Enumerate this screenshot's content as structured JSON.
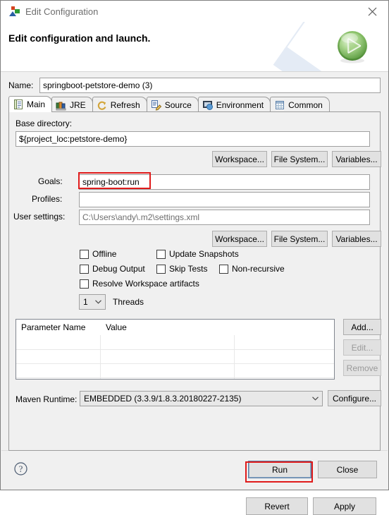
{
  "window": {
    "title": "Edit Configuration",
    "icon": "launch-config-icon",
    "close_label": "✕"
  },
  "header": {
    "title": "Edit configuration and launch.",
    "banner_icon": "run-play-icon"
  },
  "name_field": {
    "label": "Name:",
    "value": "springboot-petstore-demo (3)",
    "placeholder": ""
  },
  "tabs": [
    {
      "label": "Main",
      "icon": "main-tab-icon",
      "active": true
    },
    {
      "label": "JRE",
      "icon": "jre-tab-icon",
      "active": false
    },
    {
      "label": "Refresh",
      "icon": "refresh-tab-icon",
      "active": false
    },
    {
      "label": "Source",
      "icon": "source-tab-icon",
      "active": false
    },
    {
      "label": "Environment",
      "icon": "environment-tab-icon",
      "active": false
    },
    {
      "label": "Common",
      "icon": "common-tab-icon",
      "active": false
    }
  ],
  "main": {
    "base_directory": {
      "label": "Base directory:",
      "value": "${project_loc:petstore-demo}"
    },
    "browse_buttons_top": [
      "Workspace...",
      "File System...",
      "Variables..."
    ],
    "goals": {
      "label": "Goals:",
      "value": "spring-boot:run",
      "highlighted": true
    },
    "profiles": {
      "label": "Profiles:",
      "value": ""
    },
    "user_settings": {
      "label": "User settings:",
      "value": "C:\\Users\\andy\\.m2\\settings.xml"
    },
    "browse_buttons_bottom": [
      "Workspace...",
      "File System...",
      "Variables..."
    ],
    "checkboxes": [
      {
        "label": "Offline",
        "checked": false
      },
      {
        "label": "Update Snapshots",
        "checked": false
      },
      {
        "label": "Debug Output",
        "checked": false
      },
      {
        "label": "Skip Tests",
        "checked": false
      },
      {
        "label": "Non-recursive",
        "checked": false
      },
      {
        "label": "Resolve Workspace artifacts",
        "checked": false
      }
    ],
    "threads": {
      "value": "1",
      "label": "Threads"
    },
    "parameters_table": {
      "columns": [
        "Parameter Name",
        "Value",
        ""
      ],
      "rows": [],
      "empty_row_count": 3
    },
    "table_buttons": [
      {
        "label": "Add...",
        "enabled": true
      },
      {
        "label": "Edit...",
        "enabled": false
      },
      {
        "label": "Remove",
        "enabled": false
      }
    ],
    "maven_runtime": {
      "label": "Maven Runtime:",
      "value": "EMBEDDED (3.3.9/1.8.3.20180227-2135)",
      "configure_label": "Configure..."
    },
    "revert_label": "Revert",
    "apply_label": "Apply"
  },
  "footer": {
    "help_icon": "help-icon",
    "run_label": "Run",
    "close_label": "Close",
    "run_highlighted": true
  },
  "colors": {
    "highlight": "#e01b1b",
    "dialog_bg": "#f0f0f0",
    "field_bg": "#ffffff",
    "accent_green": "#69b749",
    "banner_blue": "#e4ebf5"
  }
}
